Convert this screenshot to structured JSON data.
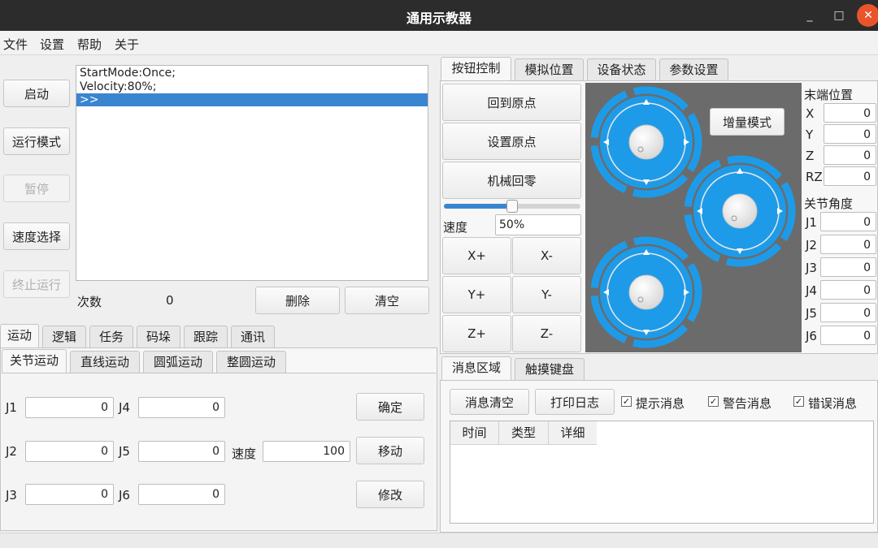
{
  "window": {
    "title": "通用示教器",
    "min": "_",
    "max": "□",
    "close": "✕"
  },
  "menu": [
    "文件",
    "设置",
    "帮助",
    "关于"
  ],
  "left_buttons": {
    "start": "启动",
    "run_mode": "运行模式",
    "pause": "暂停",
    "speed_select": "速度选择",
    "stop_run": "终止运行"
  },
  "log": {
    "lines": [
      "StartMode:Once;",
      "Velocity:80%;",
      ">>"
    ]
  },
  "count": {
    "label": "次数",
    "value": "0"
  },
  "log_buttons": {
    "delete": "删除",
    "clear": "清空"
  },
  "bottom_tabs": [
    "运动",
    "逻辑",
    "任务",
    "码垛",
    "跟踪",
    "通讯"
  ],
  "motion_tabs": [
    "关节运动",
    "直线运动",
    "圆弧运动",
    "整圆运动"
  ],
  "joint_motion": {
    "J1": "0",
    "J2": "0",
    "J3": "0",
    "J4": "0",
    "J5": "0",
    "J6": "0",
    "speed_label": "速度",
    "speed": "100",
    "confirm": "确定",
    "move": "移动",
    "modify": "修改"
  },
  "right_tabs": [
    "按钮控制",
    "模拟位置",
    "设备状态",
    "参数设置"
  ],
  "jog": {
    "home": "回到原点",
    "set_home": "设置原点",
    "mech_home": "机械回零",
    "speed_label": "速度",
    "speed_value": "50%",
    "speed_fraction": 0.5,
    "xp": "X+",
    "xm": "X-",
    "yp": "Y+",
    "ym": "Y-",
    "zp": "Z+",
    "zm": "Z-",
    "incr_mode": "增量模式"
  },
  "end_pos": {
    "title": "末端位置",
    "X": "0",
    "Y": "0",
    "Z": "0",
    "RZ": "0"
  },
  "joint_angle": {
    "title": "关节角度",
    "J1": "0",
    "J2": "0",
    "J3": "0",
    "J4": "0",
    "J5": "0",
    "J6": "0"
  },
  "msg_tabs": [
    "消息区域",
    "触摸键盘"
  ],
  "msg": {
    "clear": "消息清空",
    "print": "打印日志",
    "hint": "提示消息",
    "warn": "警告消息",
    "error": "错误消息",
    "cols": [
      "时间",
      "类型",
      "详细"
    ]
  },
  "colors": {
    "accent": "#3a85d0",
    "joystick": "#1e9be8",
    "jog_bg": "#6b6b6b"
  }
}
